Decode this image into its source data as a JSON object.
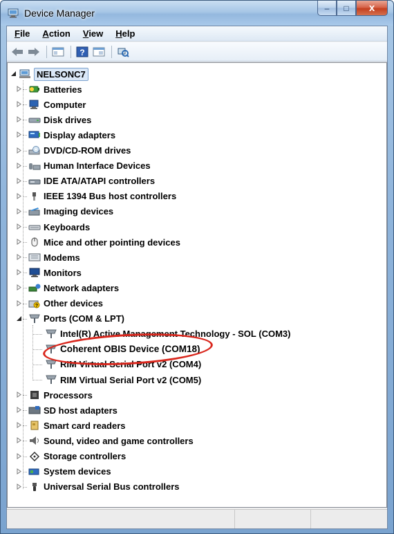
{
  "window": {
    "title": "Device Manager"
  },
  "caption_buttons": {
    "minimize": "–",
    "maximize": "□",
    "close": "x"
  },
  "menu": [
    {
      "label": "File",
      "key": "F",
      "rest": "ile"
    },
    {
      "label": "Action",
      "key": "A",
      "rest": "ction"
    },
    {
      "label": "View",
      "key": "V",
      "rest": "iew"
    },
    {
      "label": "Help",
      "key": "H",
      "rest": "elp"
    }
  ],
  "toolbar": {
    "buttons": [
      "back-icon",
      "forward-icon",
      "console-tree-icon",
      "help-icon",
      "properties-icon",
      "scan-hardware-icon"
    ]
  },
  "tree": {
    "root": "NELSONC7",
    "categories": [
      "Batteries",
      "Computer",
      "Disk drives",
      "Display adapters",
      "DVD/CD-ROM drives",
      "Human Interface Devices",
      "IDE ATA/ATAPI controllers",
      "IEEE 1394 Bus host controllers",
      "Imaging devices",
      "Keyboards",
      "Mice and other pointing devices",
      "Modems",
      "Monitors",
      "Network adapters",
      "Other devices",
      "Ports (COM & LPT)"
    ],
    "ports_children": [
      "Intel(R) Active Management Technology - SOL (COM3)",
      "Coherent OBIS Device (COM18)",
      "RIM Virtual Serial Port v2 (COM4)",
      "RIM Virtual Serial Port v2 (COM5)"
    ],
    "categories_after": [
      "Processors",
      "SD host adapters",
      "Smart card readers",
      "Sound, video and game controllers",
      "Storage controllers",
      "System devices",
      "Universal Serial Bus controllers"
    ]
  },
  "colors": {
    "highlight_ellipse": "#d9261c",
    "selection": "#dbe8f7"
  }
}
